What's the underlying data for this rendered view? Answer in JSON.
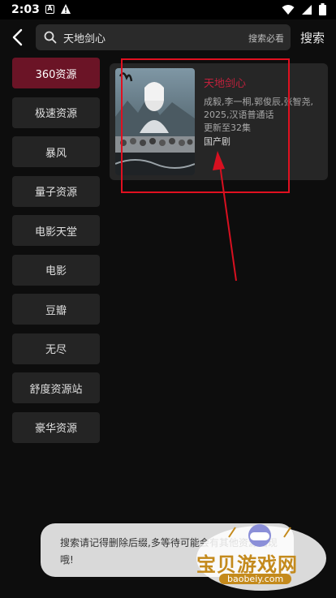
{
  "status": {
    "time": "2:03",
    "notif_letter": "A"
  },
  "search": {
    "query": "天地剑心",
    "hint": "搜索必看",
    "button_label": "搜索"
  },
  "sources": [
    {
      "label": "360资源",
      "active": true
    },
    {
      "label": "极速资源"
    },
    {
      "label": "暴风"
    },
    {
      "label": "量子资源"
    },
    {
      "label": "电影天堂"
    },
    {
      "label": "电影"
    },
    {
      "label": "豆瓣"
    },
    {
      "label": "无尽"
    },
    {
      "label": "舒度资源站"
    },
    {
      "label": "豪华资源"
    }
  ],
  "result": {
    "title": "天地剑心",
    "cast": "成毅,李一桐,郭俊辰,张智尧,",
    "year_lang": "2025,汉语普通话",
    "update": "更新至32集",
    "region": "国产剧"
  },
  "toast": {
    "message": "搜索请记得删除后缀,多等待可能会有其他资源出现哦!"
  },
  "watermark": {
    "text": "宝贝游戏网",
    "url": "baobeiy.com"
  },
  "colors": {
    "accent": "#c0213c",
    "active_source": "#6b1426",
    "highlight": "#e01020"
  }
}
